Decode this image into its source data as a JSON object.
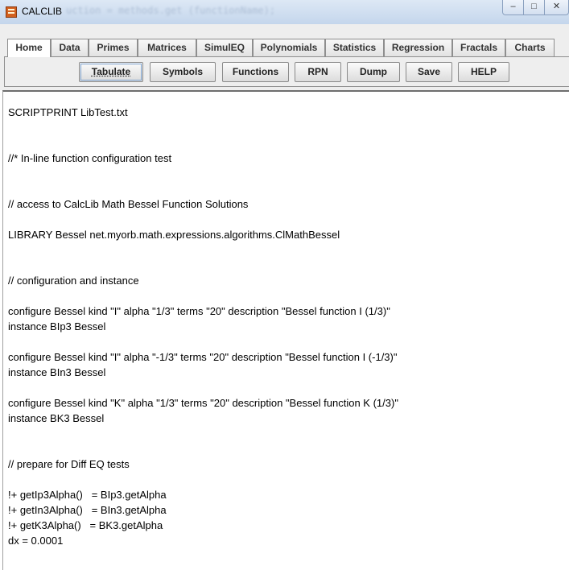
{
  "window": {
    "title": "CALCLIB",
    "ghost_text": "uction = methods.get (functionName);",
    "controls": {
      "minimize": "–",
      "maximize": "□",
      "close": "✕"
    }
  },
  "tabs": [
    {
      "label": "Home",
      "active": true
    },
    {
      "label": "Data"
    },
    {
      "label": "Primes"
    },
    {
      "label": "Matrices"
    },
    {
      "label": "SimulEQ"
    },
    {
      "label": "Polynomials"
    },
    {
      "label": "Statistics"
    },
    {
      "label": "Regression"
    },
    {
      "label": "Fractals"
    },
    {
      "label": "Charts"
    }
  ],
  "toolbar": {
    "tabulate": "Tabulate",
    "symbols": "Symbols",
    "functions": "Functions",
    "rpn": "RPN",
    "dump": "Dump",
    "save": "Save",
    "help": "HELP"
  },
  "editor": {
    "lines": [
      "SCRIPTPRINT LibTest.txt",
      "//* In-line function configuration test",
      "// access to CalcLib Math Bessel Function Solutions",
      "LIBRARY Bessel net.myorb.math.expressions.algorithms.ClMathBessel",
      "// configuration and instance",
      "configure Bessel kind \"I\" alpha \"1/3\" terms \"20\" description \"Bessel function I (1/3)\"",
      "instance BIp3 Bessel",
      "configure Bessel kind \"I\" alpha \"-1/3\" terms \"20\" description \"Bessel function I (-1/3)\"",
      "instance BIn3 Bessel",
      "configure Bessel kind \"K\" alpha \"1/3\" terms \"20\" description \"Bessel function K (1/3)\"",
      "instance BK3 Bessel",
      "// prepare for Diff EQ tests",
      "!+ getIp3Alpha()   = BIp3.getAlpha",
      "!+ getIn3Alpha()   = BIn3.getAlpha",
      "!+ getK3Alpha()   = BK3.getAlpha",
      "dx = 0.0001"
    ]
  }
}
